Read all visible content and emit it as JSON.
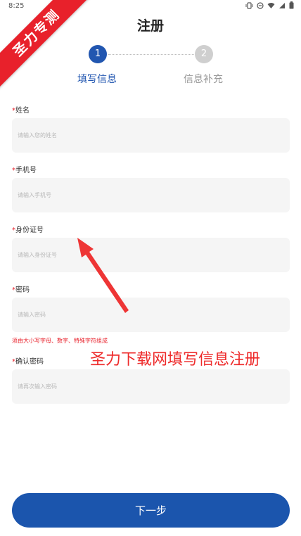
{
  "status_bar": {
    "time": "8:25"
  },
  "ribbon": {
    "text": "圣力专测"
  },
  "header": {
    "title": "注册"
  },
  "stepper": {
    "steps": [
      {
        "number": "1",
        "label": "填写信息",
        "active": true
      },
      {
        "number": "2",
        "label": "信息补充",
        "active": false
      }
    ]
  },
  "form": {
    "required_mark": "*",
    "fields": [
      {
        "label": "姓名",
        "placeholder": "请输入您的姓名",
        "value": ""
      },
      {
        "label": "手机号",
        "placeholder": "请输入手机号",
        "value": ""
      },
      {
        "label": "身份证号",
        "placeholder": "请输入身份证号",
        "value": ""
      },
      {
        "label": "密码",
        "placeholder": "请输入密码",
        "value": ""
      },
      {
        "label": "确认密码",
        "placeholder": "请再次输入密码",
        "value": ""
      }
    ],
    "password_hint": "须由大小写字母、数字、特殊字符组成"
  },
  "watermark": {
    "text": "圣力下载网填写信息注册"
  },
  "footer": {
    "next_label": "下一步"
  },
  "colors": {
    "primary": "#1b55ad",
    "accent_red": "#e8212b",
    "field_bg": "#f5f5f5"
  }
}
